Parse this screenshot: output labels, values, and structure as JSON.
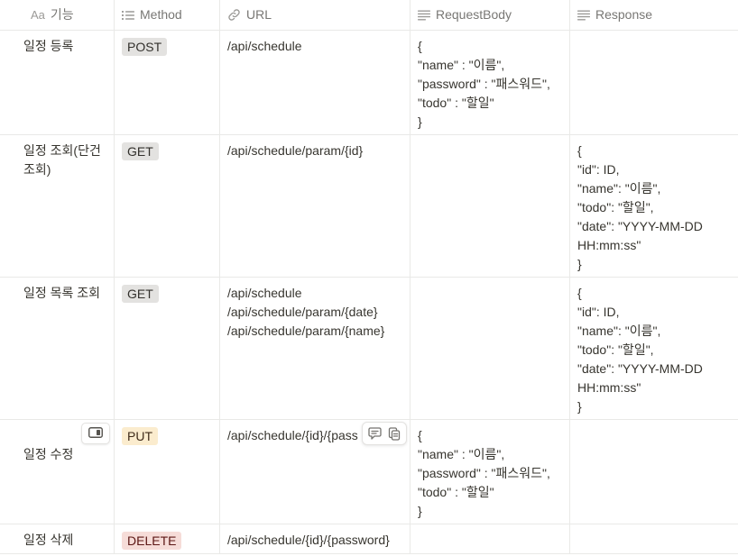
{
  "columns": {
    "feature": {
      "label": "기능",
      "icon_prefix": "Aa"
    },
    "method": {
      "label": "Method"
    },
    "url": {
      "label": "URL"
    },
    "request": {
      "label": "RequestBody"
    },
    "response": {
      "label": "Response"
    }
  },
  "rows": [
    {
      "feature": "일정 등록",
      "method": "POST",
      "method_color": "#e3e2e0",
      "url": "/api/schedule",
      "request": "{\n\"name\" : \"이름\",\n\"password\" : \"패스워드\",\n\"todo\" : \"할일\"\n}",
      "response": ""
    },
    {
      "feature": "일정 조회(단건\n조회)",
      "method": "GET",
      "method_color": "#e3e2e0",
      "url": "/api/schedule/param/{id}",
      "request": "",
      "response": "{\n\"id\": ID,\n\"name\": \"이름\",\n\"todo\": \"할일\",\n\"date\": \"YYYY-MM-DD\nHH:mm:ss\"\n}"
    },
    {
      "feature": "일정 목록 조회",
      "method": "GET",
      "method_color": "#e3e2e0",
      "url": "/api/schedule\n/api/schedule/param/{date}\n/api/schedule/param/{name}",
      "request": "",
      "response": "{\n\"id\": ID,\n\"name\": \"이름\",\n\"todo\": \"할일\",\n\"date\": \"YYYY-MM-DD\nHH:mm:ss\"\n}"
    },
    {
      "feature": "일정 수정",
      "method": "PUT",
      "method_color": "#fbecce",
      "url": "/api/schedule/{id}/{pass",
      "request": "{\n\"name\" : \"이름\",\n\"password\" : \"패스워드\",\n\"todo\" : \"할일\"\n}",
      "response": ""
    },
    {
      "feature": "일정 삭제",
      "method": "DELETE",
      "method_color": "#f6dcd8",
      "url": "/api/schedule/{id}/{password}",
      "request": "",
      "response": ""
    }
  ],
  "icons": {
    "feature_header": "title-property-icon",
    "method_header": "list-property-icon",
    "url_header": "link-icon",
    "request_header": "text-property-icon",
    "response_header": "text-property-icon",
    "open_page": "open-side-peek-icon",
    "comment": "comment-icon",
    "copy": "copy-icon"
  }
}
